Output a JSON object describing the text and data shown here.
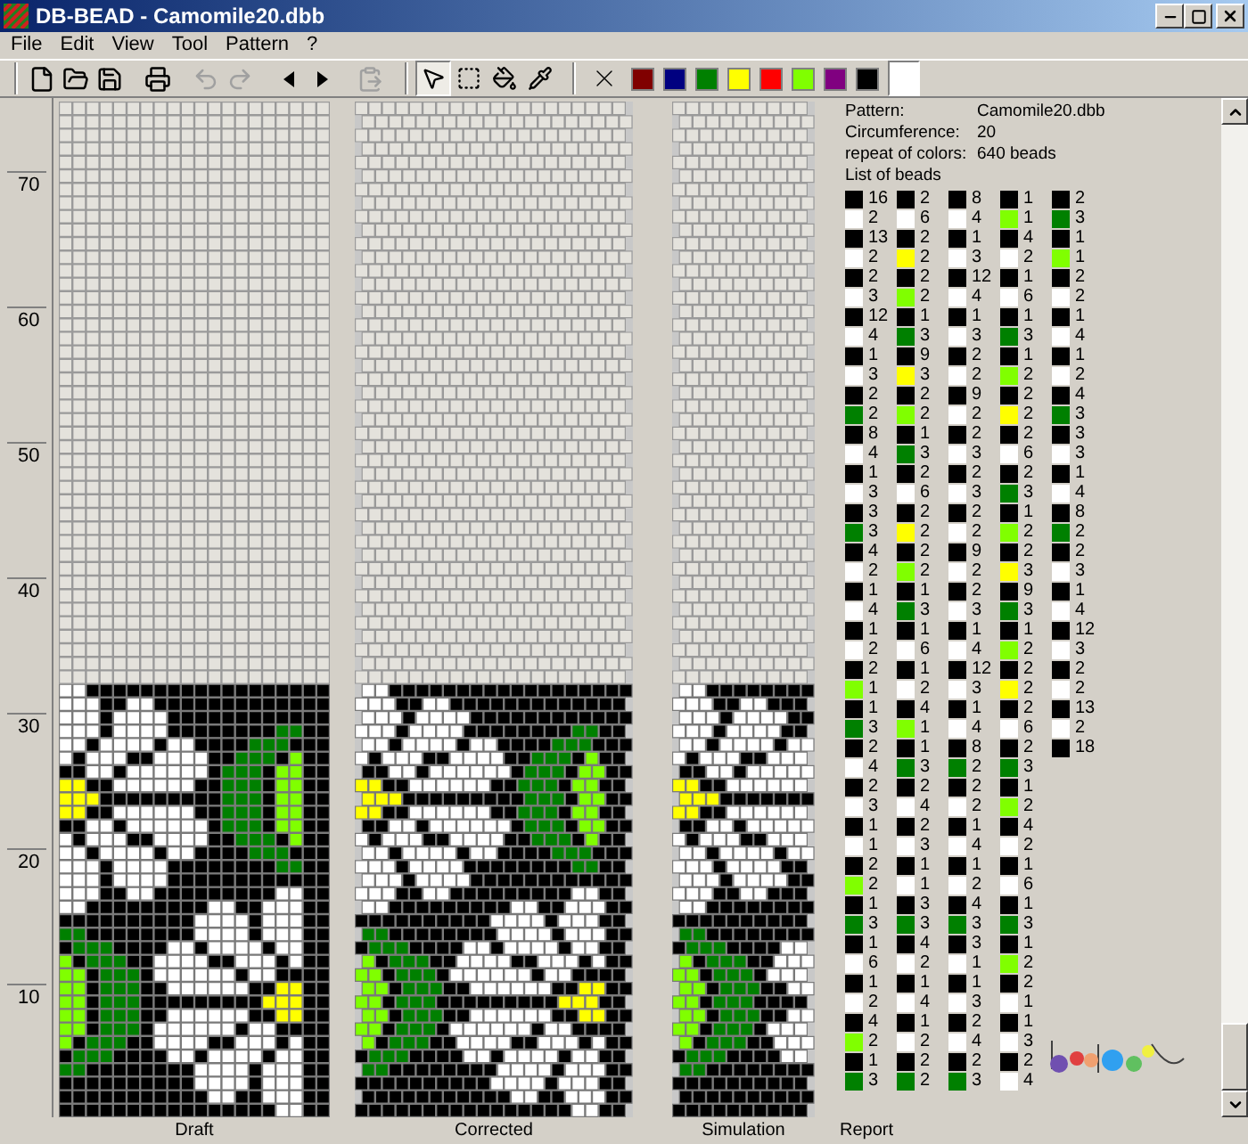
{
  "window": {
    "title": "DB-BEAD - Camomile20.dbb"
  },
  "menu": [
    "File",
    "Edit",
    "View",
    "Tool",
    "Pattern",
    "?"
  ],
  "toolbar": {
    "actions": [
      {
        "kind": "new",
        "disabled": false
      },
      {
        "kind": "open",
        "disabled": false
      },
      {
        "kind": "save",
        "disabled": false
      },
      {
        "kind": "print",
        "disabled": false
      },
      {
        "kind": "undo",
        "disabled": true
      },
      {
        "kind": "redo",
        "disabled": true
      },
      {
        "kind": "prev",
        "disabled": false
      },
      {
        "kind": "next",
        "disabled": false
      },
      {
        "kind": "paste",
        "disabled": true
      }
    ],
    "tools": [
      {
        "kind": "pointer",
        "selected": true
      },
      {
        "kind": "select",
        "selected": false
      },
      {
        "kind": "fill",
        "selected": false
      },
      {
        "kind": "picker",
        "selected": false
      }
    ],
    "palette": [
      {
        "color": "#800000",
        "selected": false
      },
      {
        "color": "#000080",
        "selected": false
      },
      {
        "color": "#008000",
        "selected": false
      },
      {
        "color": "#ffff00",
        "selected": false
      },
      {
        "color": "#ff0000",
        "selected": false
      },
      {
        "color": "#80ff00",
        "selected": false
      },
      {
        "color": "#800080",
        "selected": false
      },
      {
        "color": "#000000",
        "selected": false
      },
      {
        "color": "#ffffff",
        "selected": true
      }
    ]
  },
  "ruler": [
    "70",
    "60",
    "50",
    "40",
    "30",
    "20",
    "10"
  ],
  "panels": [
    {
      "kind": "draft",
      "label": "Draft"
    },
    {
      "kind": "corrected",
      "label": "Corrected"
    },
    {
      "kind": "simulation",
      "label": "Simulation"
    }
  ],
  "report": {
    "label": "Report",
    "info": [
      {
        "label": "Pattern:",
        "value": "Camomile20.dbb"
      },
      {
        "label": "Circumference:",
        "value": "20"
      },
      {
        "label": "repeat of colors:",
        "value": "640 beads"
      }
    ],
    "list_title": "List of beads",
    "columns": [
      [
        {
          "color": "#000000",
          "count": "16"
        },
        {
          "color": "#ffffff",
          "count": "2"
        },
        {
          "color": "#000000",
          "count": "13"
        },
        {
          "color": "#ffffff",
          "count": "2"
        },
        {
          "color": "#000000",
          "count": "2"
        },
        {
          "color": "#ffffff",
          "count": "3"
        },
        {
          "color": "#000000",
          "count": "12"
        },
        {
          "color": "#ffffff",
          "count": "4"
        },
        {
          "color": "#000000",
          "count": "1"
        },
        {
          "color": "#ffffff",
          "count": "3"
        },
        {
          "color": "#000000",
          "count": "2"
        },
        {
          "color": "#008000",
          "count": "2"
        },
        {
          "color": "#000000",
          "count": "8"
        },
        {
          "color": "#ffffff",
          "count": "4"
        },
        {
          "color": "#000000",
          "count": "1"
        },
        {
          "color": "#ffffff",
          "count": "3"
        },
        {
          "color": "#000000",
          "count": "3"
        },
        {
          "color": "#008000",
          "count": "3"
        },
        {
          "color": "#000000",
          "count": "4"
        },
        {
          "color": "#ffffff",
          "count": "2"
        },
        {
          "color": "#000000",
          "count": "1"
        },
        {
          "color": "#ffffff",
          "count": "4"
        },
        {
          "color": "#000000",
          "count": "1"
        },
        {
          "color": "#ffffff",
          "count": "2"
        },
        {
          "color": "#000000",
          "count": "2"
        },
        {
          "color": "#80ff00",
          "count": "1"
        },
        {
          "color": "#000000",
          "count": "1"
        },
        {
          "color": "#008000",
          "count": "3"
        },
        {
          "color": "#000000",
          "count": "2"
        },
        {
          "color": "#ffffff",
          "count": "4"
        },
        {
          "color": "#000000",
          "count": "2"
        },
        {
          "color": "#ffffff",
          "count": "3"
        },
        {
          "color": "#000000",
          "count": "1"
        },
        {
          "color": "#ffffff",
          "count": "1"
        },
        {
          "color": "#000000",
          "count": "2"
        },
        {
          "color": "#80ff00",
          "count": "2"
        },
        {
          "color": "#000000",
          "count": "1"
        },
        {
          "color": "#008000",
          "count": "3"
        },
        {
          "color": "#000000",
          "count": "1"
        },
        {
          "color": "#ffffff",
          "count": "6"
        },
        {
          "color": "#000000",
          "count": "1"
        },
        {
          "color": "#ffffff",
          "count": "2"
        },
        {
          "color": "#000000",
          "count": "4"
        },
        {
          "color": "#80ff00",
          "count": "2"
        },
        {
          "color": "#000000",
          "count": "1"
        },
        {
          "color": "#008000",
          "count": "3"
        }
      ],
      [
        {
          "color": "#000000",
          "count": "2"
        },
        {
          "color": "#ffffff",
          "count": "6"
        },
        {
          "color": "#000000",
          "count": "2"
        },
        {
          "color": "#ffff00",
          "count": "2"
        },
        {
          "color": "#000000",
          "count": "2"
        },
        {
          "color": "#80ff00",
          "count": "2"
        },
        {
          "color": "#000000",
          "count": "1"
        },
        {
          "color": "#008000",
          "count": "3"
        },
        {
          "color": "#000000",
          "count": "9"
        },
        {
          "color": "#ffff00",
          "count": "3"
        },
        {
          "color": "#000000",
          "count": "2"
        },
        {
          "color": "#80ff00",
          "count": "2"
        },
        {
          "color": "#000000",
          "count": "1"
        },
        {
          "color": "#008000",
          "count": "3"
        },
        {
          "color": "#000000",
          "count": "2"
        },
        {
          "color": "#ffffff",
          "count": "6"
        },
        {
          "color": "#000000",
          "count": "2"
        },
        {
          "color": "#ffff00",
          "count": "2"
        },
        {
          "color": "#000000",
          "count": "2"
        },
        {
          "color": "#80ff00",
          "count": "2"
        },
        {
          "color": "#000000",
          "count": "1"
        },
        {
          "color": "#008000",
          "count": "3"
        },
        {
          "color": "#000000",
          "count": "1"
        },
        {
          "color": "#ffffff",
          "count": "6"
        },
        {
          "color": "#000000",
          "count": "1"
        },
        {
          "color": "#ffffff",
          "count": "2"
        },
        {
          "color": "#000000",
          "count": "4"
        },
        {
          "color": "#80ff00",
          "count": "1"
        },
        {
          "color": "#000000",
          "count": "1"
        },
        {
          "color": "#008000",
          "count": "3"
        },
        {
          "color": "#000000",
          "count": "2"
        },
        {
          "color": "#ffffff",
          "count": "4"
        },
        {
          "color": "#000000",
          "count": "2"
        },
        {
          "color": "#ffffff",
          "count": "3"
        },
        {
          "color": "#000000",
          "count": "1"
        },
        {
          "color": "#ffffff",
          "count": "1"
        },
        {
          "color": "#000000",
          "count": "3"
        },
        {
          "color": "#008000",
          "count": "3"
        },
        {
          "color": "#000000",
          "count": "4"
        },
        {
          "color": "#ffffff",
          "count": "2"
        },
        {
          "color": "#000000",
          "count": "1"
        },
        {
          "color": "#ffffff",
          "count": "4"
        },
        {
          "color": "#000000",
          "count": "1"
        },
        {
          "color": "#ffffff",
          "count": "2"
        },
        {
          "color": "#000000",
          "count": "2"
        },
        {
          "color": "#008000",
          "count": "2"
        }
      ],
      [
        {
          "color": "#000000",
          "count": "8"
        },
        {
          "color": "#ffffff",
          "count": "4"
        },
        {
          "color": "#000000",
          "count": "1"
        },
        {
          "color": "#ffffff",
          "count": "3"
        },
        {
          "color": "#000000",
          "count": "12"
        },
        {
          "color": "#ffffff",
          "count": "4"
        },
        {
          "color": "#000000",
          "count": "1"
        },
        {
          "color": "#ffffff",
          "count": "3"
        },
        {
          "color": "#000000",
          "count": "2"
        },
        {
          "color": "#ffffff",
          "count": "2"
        },
        {
          "color": "#000000",
          "count": "9"
        },
        {
          "color": "#ffffff",
          "count": "2"
        },
        {
          "color": "#000000",
          "count": "2"
        },
        {
          "color": "#ffffff",
          "count": "3"
        },
        {
          "color": "#000000",
          "count": "2"
        },
        {
          "color": "#ffffff",
          "count": "3"
        },
        {
          "color": "#000000",
          "count": "2"
        },
        {
          "color": "#ffffff",
          "count": "2"
        },
        {
          "color": "#000000",
          "count": "9"
        },
        {
          "color": "#ffffff",
          "count": "2"
        },
        {
          "color": "#000000",
          "count": "2"
        },
        {
          "color": "#ffffff",
          "count": "3"
        },
        {
          "color": "#000000",
          "count": "1"
        },
        {
          "color": "#ffffff",
          "count": "4"
        },
        {
          "color": "#000000",
          "count": "12"
        },
        {
          "color": "#ffffff",
          "count": "3"
        },
        {
          "color": "#000000",
          "count": "1"
        },
        {
          "color": "#ffffff",
          "count": "4"
        },
        {
          "color": "#000000",
          "count": "8"
        },
        {
          "color": "#008000",
          "count": "2"
        },
        {
          "color": "#000000",
          "count": "2"
        },
        {
          "color": "#ffffff",
          "count": "2"
        },
        {
          "color": "#000000",
          "count": "1"
        },
        {
          "color": "#ffffff",
          "count": "4"
        },
        {
          "color": "#000000",
          "count": "1"
        },
        {
          "color": "#ffffff",
          "count": "2"
        },
        {
          "color": "#000000",
          "count": "4"
        },
        {
          "color": "#008000",
          "count": "3"
        },
        {
          "color": "#000000",
          "count": "3"
        },
        {
          "color": "#ffffff",
          "count": "1"
        },
        {
          "color": "#000000",
          "count": "1"
        },
        {
          "color": "#ffffff",
          "count": "3"
        },
        {
          "color": "#000000",
          "count": "2"
        },
        {
          "color": "#ffffff",
          "count": "4"
        },
        {
          "color": "#000000",
          "count": "2"
        },
        {
          "color": "#008000",
          "count": "3"
        }
      ],
      [
        {
          "color": "#000000",
          "count": "1"
        },
        {
          "color": "#80ff00",
          "count": "1"
        },
        {
          "color": "#000000",
          "count": "4"
        },
        {
          "color": "#ffffff",
          "count": "2"
        },
        {
          "color": "#000000",
          "count": "1"
        },
        {
          "color": "#ffffff",
          "count": "6"
        },
        {
          "color": "#000000",
          "count": "1"
        },
        {
          "color": "#008000",
          "count": "3"
        },
        {
          "color": "#000000",
          "count": "1"
        },
        {
          "color": "#80ff00",
          "count": "2"
        },
        {
          "color": "#000000",
          "count": "2"
        },
        {
          "color": "#ffff00",
          "count": "2"
        },
        {
          "color": "#000000",
          "count": "2"
        },
        {
          "color": "#ffffff",
          "count": "6"
        },
        {
          "color": "#000000",
          "count": "2"
        },
        {
          "color": "#008000",
          "count": "3"
        },
        {
          "color": "#000000",
          "count": "1"
        },
        {
          "color": "#80ff00",
          "count": "2"
        },
        {
          "color": "#000000",
          "count": "2"
        },
        {
          "color": "#ffff00",
          "count": "3"
        },
        {
          "color": "#000000",
          "count": "9"
        },
        {
          "color": "#008000",
          "count": "3"
        },
        {
          "color": "#000000",
          "count": "1"
        },
        {
          "color": "#80ff00",
          "count": "2"
        },
        {
          "color": "#000000",
          "count": "2"
        },
        {
          "color": "#ffff00",
          "count": "2"
        },
        {
          "color": "#000000",
          "count": "2"
        },
        {
          "color": "#ffffff",
          "count": "6"
        },
        {
          "color": "#000000",
          "count": "2"
        },
        {
          "color": "#008000",
          "count": "3"
        },
        {
          "color": "#000000",
          "count": "1"
        },
        {
          "color": "#80ff00",
          "count": "2"
        },
        {
          "color": "#000000",
          "count": "4"
        },
        {
          "color": "#ffffff",
          "count": "2"
        },
        {
          "color": "#000000",
          "count": "1"
        },
        {
          "color": "#ffffff",
          "count": "6"
        },
        {
          "color": "#000000",
          "count": "1"
        },
        {
          "color": "#008000",
          "count": "3"
        },
        {
          "color": "#000000",
          "count": "1"
        },
        {
          "color": "#80ff00",
          "count": "2"
        },
        {
          "color": "#000000",
          "count": "2"
        },
        {
          "color": "#ffffff",
          "count": "1"
        },
        {
          "color": "#000000",
          "count": "1"
        },
        {
          "color": "#ffffff",
          "count": "3"
        },
        {
          "color": "#000000",
          "count": "2"
        },
        {
          "color": "#ffffff",
          "count": "4"
        }
      ],
      [
        {
          "color": "#000000",
          "count": "2"
        },
        {
          "color": "#008000",
          "count": "3"
        },
        {
          "color": "#000000",
          "count": "1"
        },
        {
          "color": "#80ff00",
          "count": "1"
        },
        {
          "color": "#000000",
          "count": "2"
        },
        {
          "color": "#ffffff",
          "count": "2"
        },
        {
          "color": "#000000",
          "count": "1"
        },
        {
          "color": "#ffffff",
          "count": "4"
        },
        {
          "color": "#000000",
          "count": "1"
        },
        {
          "color": "#ffffff",
          "count": "2"
        },
        {
          "color": "#000000",
          "count": "4"
        },
        {
          "color": "#008000",
          "count": "3"
        },
        {
          "color": "#000000",
          "count": "3"
        },
        {
          "color": "#ffffff",
          "count": "3"
        },
        {
          "color": "#000000",
          "count": "1"
        },
        {
          "color": "#ffffff",
          "count": "4"
        },
        {
          "color": "#000000",
          "count": "8"
        },
        {
          "color": "#008000",
          "count": "2"
        },
        {
          "color": "#000000",
          "count": "2"
        },
        {
          "color": "#ffffff",
          "count": "3"
        },
        {
          "color": "#000000",
          "count": "1"
        },
        {
          "color": "#ffffff",
          "count": "4"
        },
        {
          "color": "#000000",
          "count": "12"
        },
        {
          "color": "#ffffff",
          "count": "3"
        },
        {
          "color": "#000000",
          "count": "2"
        },
        {
          "color": "#ffffff",
          "count": "2"
        },
        {
          "color": "#000000",
          "count": "13"
        },
        {
          "color": "#ffffff",
          "count": "2"
        },
        {
          "color": "#000000",
          "count": "18"
        }
      ]
    ]
  }
}
